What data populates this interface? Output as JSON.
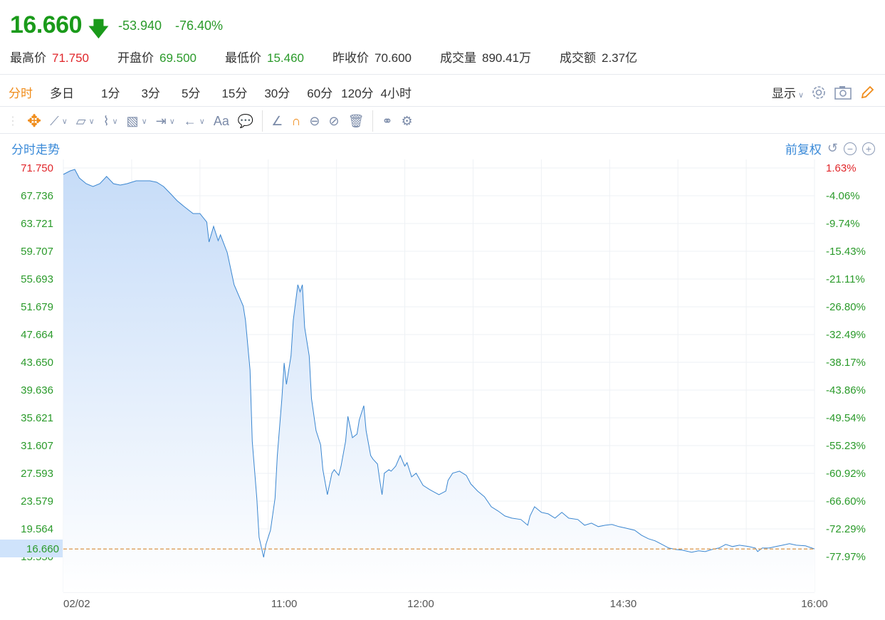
{
  "quote": {
    "price": "16.660",
    "change": "-53.940",
    "change_pct": "-76.40%"
  },
  "stats": [
    {
      "label": "最高价",
      "value": "71.750",
      "color": "#e0262a"
    },
    {
      "label": "开盘价",
      "value": "69.500",
      "color": "#2a9a2a"
    },
    {
      "label": "最低价",
      "value": "15.460",
      "color": "#2a9a2a"
    },
    {
      "label": "昨收价",
      "value": "70.600",
      "color": "#333333"
    },
    {
      "label": "成交量",
      "value": "890.41万",
      "color": "#333333"
    },
    {
      "label": "成交额",
      "value": "2.37亿",
      "color": "#333333"
    }
  ],
  "periods": [
    "分时",
    "多日",
    "1分",
    "3分",
    "5分",
    "15分",
    "30分",
    "60分",
    "120分",
    "4小时"
  ],
  "active_period": "分时",
  "display_label": "显示",
  "text_tool": "Aa",
  "chart_title": "分时走势",
  "adjust_label": "前复权",
  "colors": {
    "up": "#e0262a",
    "down": "#2a9a2a",
    "line": "#3a86d0",
    "ref": "#d9954a",
    "accent": "#f08c1a"
  },
  "chart_data": {
    "type": "area",
    "title": "分时走势",
    "current_price": "16.660",
    "prev_close": 70.6,
    "ylim": [
      15.55,
      71.75
    ],
    "xlim": [
      0,
      330
    ],
    "y_ticks": [
      "71.750",
      "67.736",
      "63.721",
      "59.707",
      "55.693",
      "51.679",
      "47.664",
      "43.650",
      "39.636",
      "35.621",
      "31.607",
      "27.593",
      "23.579",
      "19.564",
      "15.550"
    ],
    "y_ticks_right": [
      "1.63%",
      "-4.06%",
      "-9.74%",
      "-15.43%",
      "-21.11%",
      "-26.80%",
      "-32.49%",
      "-38.17%",
      "-43.86%",
      "-49.54%",
      "-55.23%",
      "-60.92%",
      "-66.60%",
      "-72.29%",
      "-77.97%"
    ],
    "x_ticks": [
      {
        "label": "02/02",
        "x": 0
      },
      {
        "label": "11:00",
        "x": 97
      },
      {
        "label": "12:00",
        "x": 157
      },
      {
        "label": "14:30",
        "x": 246
      },
      {
        "label": "16:00",
        "x": 330
      }
    ],
    "points": [
      [
        0,
        70.82
      ],
      [
        3,
        71.34
      ],
      [
        5,
        71.54
      ],
      [
        7,
        70.31
      ],
      [
        10,
        69.49
      ],
      [
        13,
        69.07
      ],
      [
        16,
        69.49
      ],
      [
        19,
        70.52
      ],
      [
        22,
        69.49
      ],
      [
        25,
        69.28
      ],
      [
        28,
        69.49
      ],
      [
        32,
        69.9
      ],
      [
        35,
        69.9
      ],
      [
        38,
        69.9
      ],
      [
        41,
        69.69
      ],
      [
        44,
        69.07
      ],
      [
        47,
        68.05
      ],
      [
        50,
        67.02
      ],
      [
        53,
        66.19
      ],
      [
        57,
        65.16
      ],
      [
        60,
        65.16
      ],
      [
        63,
        63.93
      ],
      [
        64,
        61.05
      ],
      [
        66,
        63.31
      ],
      [
        68,
        61.25
      ],
      [
        69,
        62.08
      ],
      [
        72,
        59.5
      ],
      [
        75,
        54.87
      ],
      [
        79,
        51.79
      ],
      [
        80,
        49.73
      ],
      [
        82,
        42.53
      ],
      [
        83,
        32.24
      ],
      [
        85,
        24.0
      ],
      [
        86,
        18.34
      ],
      [
        88,
        15.46
      ],
      [
        89,
        17.32
      ],
      [
        91,
        19.37
      ],
      [
        93,
        24.0
      ],
      [
        94,
        30.18
      ],
      [
        96,
        38.41
      ],
      [
        97,
        43.56
      ],
      [
        98,
        40.47
      ],
      [
        100,
        44.58
      ],
      [
        101,
        49.73
      ],
      [
        103,
        54.87
      ],
      [
        104,
        53.85
      ],
      [
        105,
        54.87
      ],
      [
        106,
        48.7
      ],
      [
        108,
        44.58
      ],
      [
        109,
        38.41
      ],
      [
        111,
        33.78
      ],
      [
        113,
        31.72
      ],
      [
        114,
        28.12
      ],
      [
        116,
        24.52
      ],
      [
        118,
        27.61
      ],
      [
        119,
        28.12
      ],
      [
        121,
        27.3
      ],
      [
        122,
        28.64
      ],
      [
        124,
        32.24
      ],
      [
        125,
        35.84
      ],
      [
        127,
        32.75
      ],
      [
        129,
        33.27
      ],
      [
        130,
        35.32
      ],
      [
        132,
        37.38
      ],
      [
        133,
        33.78
      ],
      [
        135,
        30.18
      ],
      [
        136,
        29.66
      ],
      [
        138,
        28.94
      ],
      [
        139,
        26.58
      ],
      [
        140,
        24.52
      ],
      [
        141,
        27.61
      ],
      [
        143,
        28.12
      ],
      [
        144,
        27.91
      ],
      [
        146,
        28.64
      ],
      [
        148,
        30.18
      ],
      [
        150,
        28.64
      ],
      [
        151,
        29.15
      ],
      [
        153,
        27.09
      ],
      [
        155,
        27.61
      ],
      [
        158,
        25.86
      ],
      [
        161,
        25.24
      ],
      [
        165,
        24.52
      ],
      [
        168,
        25.03
      ],
      [
        169,
        26.58
      ],
      [
        171,
        27.61
      ],
      [
        174,
        27.91
      ],
      [
        177,
        27.3
      ],
      [
        179,
        26.06
      ],
      [
        182,
        25.03
      ],
      [
        185,
        24.21
      ],
      [
        188,
        22.77
      ],
      [
        191,
        22.15
      ],
      [
        194,
        21.43
      ],
      [
        197,
        21.12
      ],
      [
        201,
        20.92
      ],
      [
        204,
        20.09
      ],
      [
        205,
        21.43
      ],
      [
        207,
        22.77
      ],
      [
        210,
        21.95
      ],
      [
        213,
        21.74
      ],
      [
        216,
        21.12
      ],
      [
        219,
        21.95
      ],
      [
        222,
        21.12
      ],
      [
        226,
        20.92
      ],
      [
        229,
        20.09
      ],
      [
        232,
        20.4
      ],
      [
        235,
        19.89
      ],
      [
        238,
        20.09
      ],
      [
        241,
        20.2
      ],
      [
        244,
        19.89
      ],
      [
        247,
        19.68
      ],
      [
        251,
        19.37
      ],
      [
        254,
        18.65
      ],
      [
        257,
        18.14
      ],
      [
        260,
        17.83
      ],
      [
        263,
        17.32
      ],
      [
        266,
        16.8
      ],
      [
        269,
        16.59
      ],
      [
        272,
        16.49
      ],
      [
        276,
        16.18
      ],
      [
        279,
        16.39
      ],
      [
        282,
        16.28
      ],
      [
        285,
        16.59
      ],
      [
        288,
        16.8
      ],
      [
        291,
        17.32
      ],
      [
        294,
        17.01
      ],
      [
        297,
        17.21
      ],
      [
        301,
        17.01
      ],
      [
        304,
        16.8
      ],
      [
        305,
        16.28
      ],
      [
        307,
        16.8
      ],
      [
        310,
        16.8
      ],
      [
        313,
        17.01
      ],
      [
        316,
        17.21
      ],
      [
        319,
        17.42
      ],
      [
        322,
        17.21
      ],
      [
        326,
        17.11
      ],
      [
        330,
        16.66
      ]
    ]
  }
}
